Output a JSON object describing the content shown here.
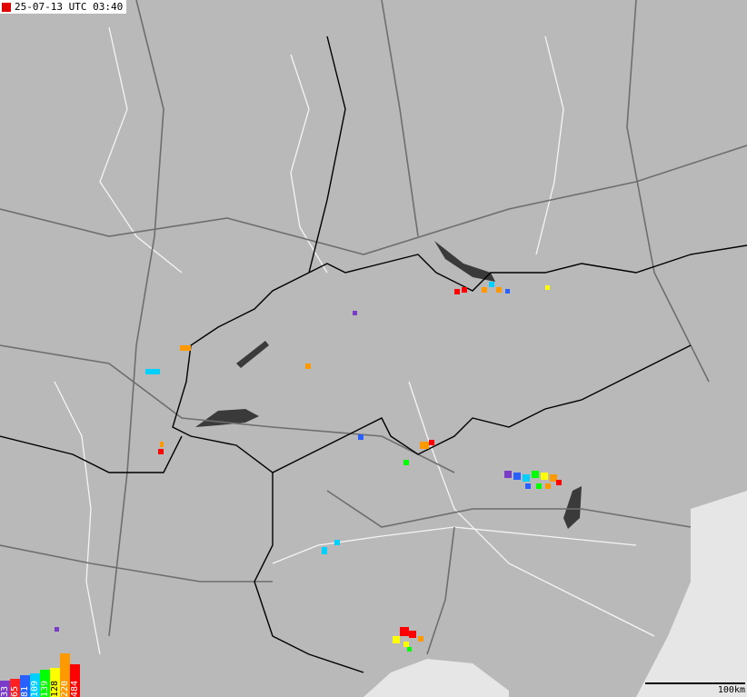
{
  "header": {
    "timestamp": "25-07-13 UTC 03:40"
  },
  "legend": {
    "items": [
      {
        "label": "33",
        "color": "#7a3cc8"
      },
      {
        "label": "65",
        "color": "#ff2020"
      },
      {
        "label": "81",
        "color": "#2a60ff"
      },
      {
        "label": "109",
        "color": "#00d0ff"
      },
      {
        "label": "139",
        "color": "#00ff00"
      },
      {
        "label": "128",
        "color": "#ffff00"
      },
      {
        "label": "220",
        "color": "#ff9900"
      },
      {
        "label": "484",
        "color": "#ff0000"
      }
    ]
  },
  "scale": {
    "label": "100km"
  },
  "colors": {
    "land": "#b9b9b9",
    "lake": "#3a3a3a",
    "sea": "#e6e6e6",
    "border": "#000000",
    "road": "#6e6e6e",
    "river": "#ffffff"
  }
}
